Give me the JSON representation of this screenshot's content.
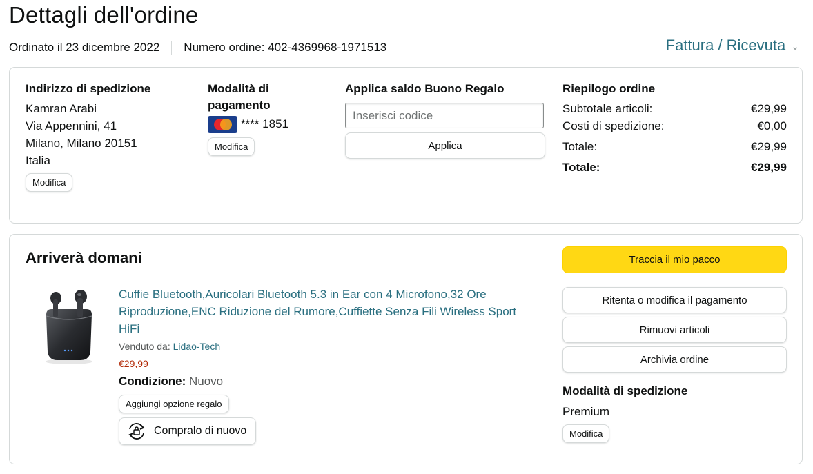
{
  "page": {
    "title": "Dettagli dell'ordine",
    "ordered_on": "Ordinato il 23 dicembre 2022",
    "order_number": "Numero ordine: 402-4369968-1971513",
    "invoice_link": "Fattura / Ricevuta"
  },
  "shipping_address": {
    "title": "Indirizzo di spedizione",
    "lines": [
      "Kamran Arabi",
      "Via Appennini, 41",
      "Milano, Milano 20151",
      "Italia"
    ],
    "edit_label": "Modifica"
  },
  "payment": {
    "title": "Modalità di pagamento",
    "card_text": "**** 1851",
    "card_icon": "mastercard-icon",
    "edit_label": "Modifica"
  },
  "gift_card": {
    "title": "Applica saldo Buono Regalo",
    "placeholder": "Inserisci codice",
    "apply_label": "Applica"
  },
  "summary": {
    "title": "Riepilogo ordine",
    "rows": [
      {
        "label": "Subtotale articoli:",
        "value": "€29,99"
      },
      {
        "label": "Costi di spedizione:",
        "value": "€0,00"
      },
      {
        "label": "Totale:",
        "value": "€29,99"
      },
      {
        "label": "Totale:",
        "value": "€29,99"
      }
    ]
  },
  "shipment": {
    "status": "Arriverà domani",
    "product": {
      "title": "Cuffie Bluetooth,Auricolari Bluetooth 5.3 in Ear con 4 Microfono,32 Ore Riproduzione,ENC Riduzione del Rumore,Cuffiette Senza Fili Wireless Sport HiFi",
      "sold_by_label": "Venduto da:",
      "seller": "Lidao-Tech",
      "price": "€29,99",
      "condition_label": "Condizione:",
      "condition": "Nuovo",
      "gift_option_label": "Aggiungi opzione regalo",
      "buy_again_label": "Compralo di nuovo"
    },
    "actions": {
      "track": "Traccia il mio pacco",
      "retry_payment": "Ritenta o modifica il pagamento",
      "remove_items": "Rimuovi articoli",
      "archive": "Archivia ordine"
    },
    "shipping_mode": {
      "title": "Modalità di spedizione",
      "value": "Premium",
      "edit_label": "Modifica"
    }
  },
  "colors": {
    "link": "#2a6f80",
    "price": "#b12704",
    "primary_button": "#ffd814",
    "border": "#d5d9d9"
  }
}
